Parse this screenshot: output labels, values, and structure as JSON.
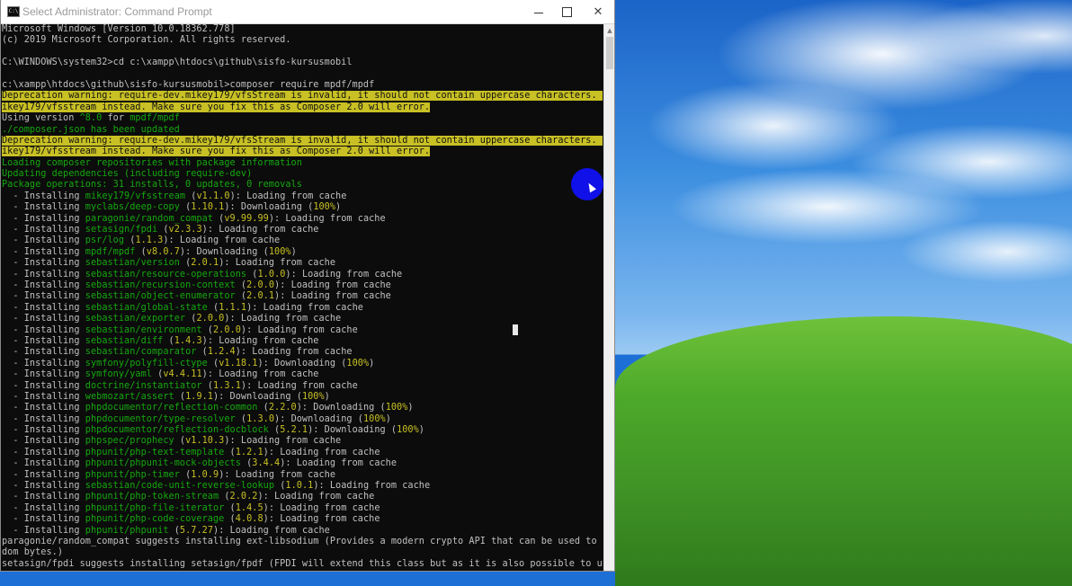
{
  "window": {
    "title": "Select Administrator: Command Prompt",
    "app_icon_text": "C:\\",
    "minimize_icon": "minimize-icon",
    "maximize_icon": "maximize-icon",
    "close_icon": "close-icon",
    "close_glyph": "✕"
  },
  "console_lines": [
    {
      "segments": [
        {
          "t": "Microsoft Windows [Version 10.0.18362.778]",
          "c": "w"
        }
      ]
    },
    {
      "segments": [
        {
          "t": "(c) 2019 Microsoft Corporation. All rights reserved.",
          "c": "w"
        }
      ]
    },
    {
      "segments": [
        {
          "t": "",
          "c": "w"
        }
      ]
    },
    {
      "segments": [
        {
          "t": "C:\\WINDOWS\\system32>cd c:\\xampp\\htdocs\\github\\sisfo-kursusmobil",
          "c": "w"
        }
      ]
    },
    {
      "segments": [
        {
          "t": "",
          "c": "w"
        }
      ]
    },
    {
      "segments": [
        {
          "t": "c:\\xampp\\htdocs\\github\\sisfo-kursusmobil>composer require mpdf/mpdf",
          "c": "w"
        }
      ]
    },
    {
      "segments": [
        {
          "t": "Deprecation warning: require-dev.mikey179/vfsStream is invalid, it should not contain uppercase characters. Please use m",
          "c": "warn"
        }
      ]
    },
    {
      "segments": [
        {
          "t": "ikey179/vfsstream instead. Make sure you fix this as Composer 2.0 will error.",
          "c": "warn"
        }
      ]
    },
    {
      "segments": [
        {
          "t": "Using version ",
          "c": "w"
        },
        {
          "t": "^8.0",
          "c": "g"
        },
        {
          "t": " for ",
          "c": "w"
        },
        {
          "t": "mpdf/mpdf",
          "c": "g"
        }
      ]
    },
    {
      "segments": [
        {
          "t": "./composer.json has been updated",
          "c": "g"
        }
      ]
    },
    {
      "segments": [
        {
          "t": "Deprecation warning: require-dev.mikey179/vfsStream is invalid, it should not contain uppercase characters. Please use m",
          "c": "warn"
        }
      ]
    },
    {
      "segments": [
        {
          "t": "ikey179/vfsstream instead. Make sure you fix this as Composer 2.0 will error.",
          "c": "warn"
        }
      ]
    },
    {
      "segments": [
        {
          "t": "Loading composer repositories with package information",
          "c": "g"
        }
      ]
    },
    {
      "segments": [
        {
          "t": "Updating dependencies (including require-dev)",
          "c": "g"
        }
      ]
    },
    {
      "segments": [
        {
          "t": "Package operations: 31 installs, 0 updates, 0 removals",
          "c": "g"
        }
      ]
    },
    {
      "segments": [
        {
          "t": "  - Installing ",
          "c": "w"
        },
        {
          "t": "mikey179/vfsstream",
          "c": "g"
        },
        {
          "t": " (",
          "c": "w"
        },
        {
          "t": "v1.1.0",
          "c": "y"
        },
        {
          "t": "): Loading from cache",
          "c": "w"
        }
      ]
    },
    {
      "segments": [
        {
          "t": "  - Installing ",
          "c": "w"
        },
        {
          "t": "myclabs/deep-copy",
          "c": "g"
        },
        {
          "t": " (",
          "c": "w"
        },
        {
          "t": "1.10.1",
          "c": "y"
        },
        {
          "t": "): Downloading (",
          "c": "w"
        },
        {
          "t": "100%",
          "c": "y"
        },
        {
          "t": ")",
          "c": "w"
        }
      ]
    },
    {
      "segments": [
        {
          "t": "  - Installing ",
          "c": "w"
        },
        {
          "t": "paragonie/random_compat",
          "c": "g"
        },
        {
          "t": " (",
          "c": "w"
        },
        {
          "t": "v9.99.99",
          "c": "y"
        },
        {
          "t": "): Loading from cache",
          "c": "w"
        }
      ]
    },
    {
      "segments": [
        {
          "t": "  - Installing ",
          "c": "w"
        },
        {
          "t": "setasign/fpdi",
          "c": "g"
        },
        {
          "t": " (",
          "c": "w"
        },
        {
          "t": "v2.3.3",
          "c": "y"
        },
        {
          "t": "): Loading from cache",
          "c": "w"
        }
      ]
    },
    {
      "segments": [
        {
          "t": "  - Installing ",
          "c": "w"
        },
        {
          "t": "psr/log",
          "c": "g"
        },
        {
          "t": " (",
          "c": "w"
        },
        {
          "t": "1.1.3",
          "c": "y"
        },
        {
          "t": "): Loading from cache",
          "c": "w"
        }
      ]
    },
    {
      "segments": [
        {
          "t": "  - Installing ",
          "c": "w"
        },
        {
          "t": "mpdf/mpdf",
          "c": "g"
        },
        {
          "t": " (",
          "c": "w"
        },
        {
          "t": "v8.0.7",
          "c": "y"
        },
        {
          "t": "): Downloading (",
          "c": "w"
        },
        {
          "t": "100%",
          "c": "y"
        },
        {
          "t": ")",
          "c": "w"
        }
      ]
    },
    {
      "segments": [
        {
          "t": "  - Installing ",
          "c": "w"
        },
        {
          "t": "sebastian/version",
          "c": "g"
        },
        {
          "t": " (",
          "c": "w"
        },
        {
          "t": "2.0.1",
          "c": "y"
        },
        {
          "t": "): Loading from cache",
          "c": "w"
        }
      ]
    },
    {
      "segments": [
        {
          "t": "  - Installing ",
          "c": "w"
        },
        {
          "t": "sebastian/resource-operations",
          "c": "g"
        },
        {
          "t": " (",
          "c": "w"
        },
        {
          "t": "1.0.0",
          "c": "y"
        },
        {
          "t": "): Loading from cache",
          "c": "w"
        }
      ]
    },
    {
      "segments": [
        {
          "t": "  - Installing ",
          "c": "w"
        },
        {
          "t": "sebastian/recursion-context",
          "c": "g"
        },
        {
          "t": " (",
          "c": "w"
        },
        {
          "t": "2.0.0",
          "c": "y"
        },
        {
          "t": "): Loading from cache",
          "c": "w"
        }
      ]
    },
    {
      "segments": [
        {
          "t": "  - Installing ",
          "c": "w"
        },
        {
          "t": "sebastian/object-enumerator",
          "c": "g"
        },
        {
          "t": " (",
          "c": "w"
        },
        {
          "t": "2.0.1",
          "c": "y"
        },
        {
          "t": "): Loading from cache",
          "c": "w"
        }
      ]
    },
    {
      "segments": [
        {
          "t": "  - Installing ",
          "c": "w"
        },
        {
          "t": "sebastian/global-state",
          "c": "g"
        },
        {
          "t": " (",
          "c": "w"
        },
        {
          "t": "1.1.1",
          "c": "y"
        },
        {
          "t": "): Loading from cache",
          "c": "w"
        }
      ]
    },
    {
      "segments": [
        {
          "t": "  - Installing ",
          "c": "w"
        },
        {
          "t": "sebastian/exporter",
          "c": "g"
        },
        {
          "t": " (",
          "c": "w"
        },
        {
          "t": "2.0.0",
          "c": "y"
        },
        {
          "t": "): Loading from cache",
          "c": "w"
        }
      ]
    },
    {
      "segments": [
        {
          "t": "  - Installing ",
          "c": "w"
        },
        {
          "t": "sebastian/environment",
          "c": "g"
        },
        {
          "t": " (",
          "c": "w"
        },
        {
          "t": "2.0.0",
          "c": "y"
        },
        {
          "t": "): Loading from cache",
          "c": "w"
        }
      ]
    },
    {
      "segments": [
        {
          "t": "  - Installing ",
          "c": "w"
        },
        {
          "t": "sebastian/diff",
          "c": "g"
        },
        {
          "t": " (",
          "c": "w"
        },
        {
          "t": "1.4.3",
          "c": "y"
        },
        {
          "t": "): Loading from cache",
          "c": "w"
        }
      ]
    },
    {
      "segments": [
        {
          "t": "  - Installing ",
          "c": "w"
        },
        {
          "t": "sebastian/comparator",
          "c": "g"
        },
        {
          "t": " (",
          "c": "w"
        },
        {
          "t": "1.2.4",
          "c": "y"
        },
        {
          "t": "): Loading from cache",
          "c": "w"
        }
      ]
    },
    {
      "segments": [
        {
          "t": "  - Installing ",
          "c": "w"
        },
        {
          "t": "symfony/polyfill-ctype",
          "c": "g"
        },
        {
          "t": " (",
          "c": "w"
        },
        {
          "t": "v1.18.1",
          "c": "y"
        },
        {
          "t": "): Downloading (",
          "c": "w"
        },
        {
          "t": "100%",
          "c": "y"
        },
        {
          "t": ")",
          "c": "w"
        }
      ]
    },
    {
      "segments": [
        {
          "t": "  - Installing ",
          "c": "w"
        },
        {
          "t": "symfony/yaml",
          "c": "g"
        },
        {
          "t": " (",
          "c": "w"
        },
        {
          "t": "v4.4.11",
          "c": "y"
        },
        {
          "t": "): Loading from cache",
          "c": "w"
        }
      ]
    },
    {
      "segments": [
        {
          "t": "  - Installing ",
          "c": "w"
        },
        {
          "t": "doctrine/instantiator",
          "c": "g"
        },
        {
          "t": " (",
          "c": "w"
        },
        {
          "t": "1.3.1",
          "c": "y"
        },
        {
          "t": "): Loading from cache",
          "c": "w"
        }
      ]
    },
    {
      "segments": [
        {
          "t": "  - Installing ",
          "c": "w"
        },
        {
          "t": "webmozart/assert",
          "c": "g"
        },
        {
          "t": " (",
          "c": "w"
        },
        {
          "t": "1.9.1",
          "c": "y"
        },
        {
          "t": "): Downloading (",
          "c": "w"
        },
        {
          "t": "100%",
          "c": "y"
        },
        {
          "t": ")",
          "c": "w"
        }
      ]
    },
    {
      "segments": [
        {
          "t": "  - Installing ",
          "c": "w"
        },
        {
          "t": "phpdocumentor/reflection-common",
          "c": "g"
        },
        {
          "t": " (",
          "c": "w"
        },
        {
          "t": "2.2.0",
          "c": "y"
        },
        {
          "t": "): Downloading (",
          "c": "w"
        },
        {
          "t": "100%",
          "c": "y"
        },
        {
          "t": ")",
          "c": "w"
        }
      ]
    },
    {
      "segments": [
        {
          "t": "  - Installing ",
          "c": "w"
        },
        {
          "t": "phpdocumentor/type-resolver",
          "c": "g"
        },
        {
          "t": " (",
          "c": "w"
        },
        {
          "t": "1.3.0",
          "c": "y"
        },
        {
          "t": "): Downloading (",
          "c": "w"
        },
        {
          "t": "100%",
          "c": "y"
        },
        {
          "t": ")",
          "c": "w"
        }
      ]
    },
    {
      "segments": [
        {
          "t": "  - Installing ",
          "c": "w"
        },
        {
          "t": "phpdocumentor/reflection-docblock",
          "c": "g"
        },
        {
          "t": " (",
          "c": "w"
        },
        {
          "t": "5.2.1",
          "c": "y"
        },
        {
          "t": "): Downloading (",
          "c": "w"
        },
        {
          "t": "100%",
          "c": "y"
        },
        {
          "t": ")",
          "c": "w"
        }
      ]
    },
    {
      "segments": [
        {
          "t": "  - Installing ",
          "c": "w"
        },
        {
          "t": "phpspec/prophecy",
          "c": "g"
        },
        {
          "t": " (",
          "c": "w"
        },
        {
          "t": "v1.10.3",
          "c": "y"
        },
        {
          "t": "): Loading from cache",
          "c": "w"
        }
      ]
    },
    {
      "segments": [
        {
          "t": "  - Installing ",
          "c": "w"
        },
        {
          "t": "phpunit/php-text-template",
          "c": "g"
        },
        {
          "t": " (",
          "c": "w"
        },
        {
          "t": "1.2.1",
          "c": "y"
        },
        {
          "t": "): Loading from cache",
          "c": "w"
        }
      ]
    },
    {
      "segments": [
        {
          "t": "  - Installing ",
          "c": "w"
        },
        {
          "t": "phpunit/phpunit-mock-objects",
          "c": "g"
        },
        {
          "t": " (",
          "c": "w"
        },
        {
          "t": "3.4.4",
          "c": "y"
        },
        {
          "t": "): Loading from cache",
          "c": "w"
        }
      ]
    },
    {
      "segments": [
        {
          "t": "  - Installing ",
          "c": "w"
        },
        {
          "t": "phpunit/php-timer",
          "c": "g"
        },
        {
          "t": " (",
          "c": "w"
        },
        {
          "t": "1.0.9",
          "c": "y"
        },
        {
          "t": "): Loading from cache",
          "c": "w"
        }
      ]
    },
    {
      "segments": [
        {
          "t": "  - Installing ",
          "c": "w"
        },
        {
          "t": "sebastian/code-unit-reverse-lookup",
          "c": "g"
        },
        {
          "t": " (",
          "c": "w"
        },
        {
          "t": "1.0.1",
          "c": "y"
        },
        {
          "t": "): Loading from cache",
          "c": "w"
        }
      ]
    },
    {
      "segments": [
        {
          "t": "  - Installing ",
          "c": "w"
        },
        {
          "t": "phpunit/php-token-stream",
          "c": "g"
        },
        {
          "t": " (",
          "c": "w"
        },
        {
          "t": "2.0.2",
          "c": "y"
        },
        {
          "t": "): Loading from cache",
          "c": "w"
        }
      ]
    },
    {
      "segments": [
        {
          "t": "  - Installing ",
          "c": "w"
        },
        {
          "t": "phpunit/php-file-iterator",
          "c": "g"
        },
        {
          "t": " (",
          "c": "w"
        },
        {
          "t": "1.4.5",
          "c": "y"
        },
        {
          "t": "): Loading from cache",
          "c": "w"
        }
      ]
    },
    {
      "segments": [
        {
          "t": "  - Installing ",
          "c": "w"
        },
        {
          "t": "phpunit/php-code-coverage",
          "c": "g"
        },
        {
          "t": " (",
          "c": "w"
        },
        {
          "t": "4.0.8",
          "c": "y"
        },
        {
          "t": "): Loading from cache",
          "c": "w"
        }
      ]
    },
    {
      "segments": [
        {
          "t": "  - Installing ",
          "c": "w"
        },
        {
          "t": "phpunit/phpunit",
          "c": "g"
        },
        {
          "t": " (",
          "c": "w"
        },
        {
          "t": "5.7.27",
          "c": "y"
        },
        {
          "t": "): Loading from cache",
          "c": "w"
        }
      ]
    },
    {
      "segments": [
        {
          "t": "paragonie/random_compat suggests installing ext-libsodium (Provides a modern crypto API that can be used to generate ran",
          "c": "w"
        }
      ]
    },
    {
      "segments": [
        {
          "t": "dom bytes.)",
          "c": "w"
        }
      ]
    },
    {
      "segments": [
        {
          "t": "setasign/fpdi suggests installing setasign/fpdf (FPDI will extend this class but as it is also possible to use TCPDF or",
          "c": "w"
        }
      ]
    }
  ],
  "scrollbar": {
    "up_glyph": "▲"
  },
  "desktop": {
    "wallpaper": "Bliss"
  },
  "colors": {
    "console_bg": "#0c0c0c",
    "console_text": "#c0c0c0",
    "green": "#15a80f",
    "yellow": "#c8c024",
    "click_indicator": "#1010e8"
  }
}
